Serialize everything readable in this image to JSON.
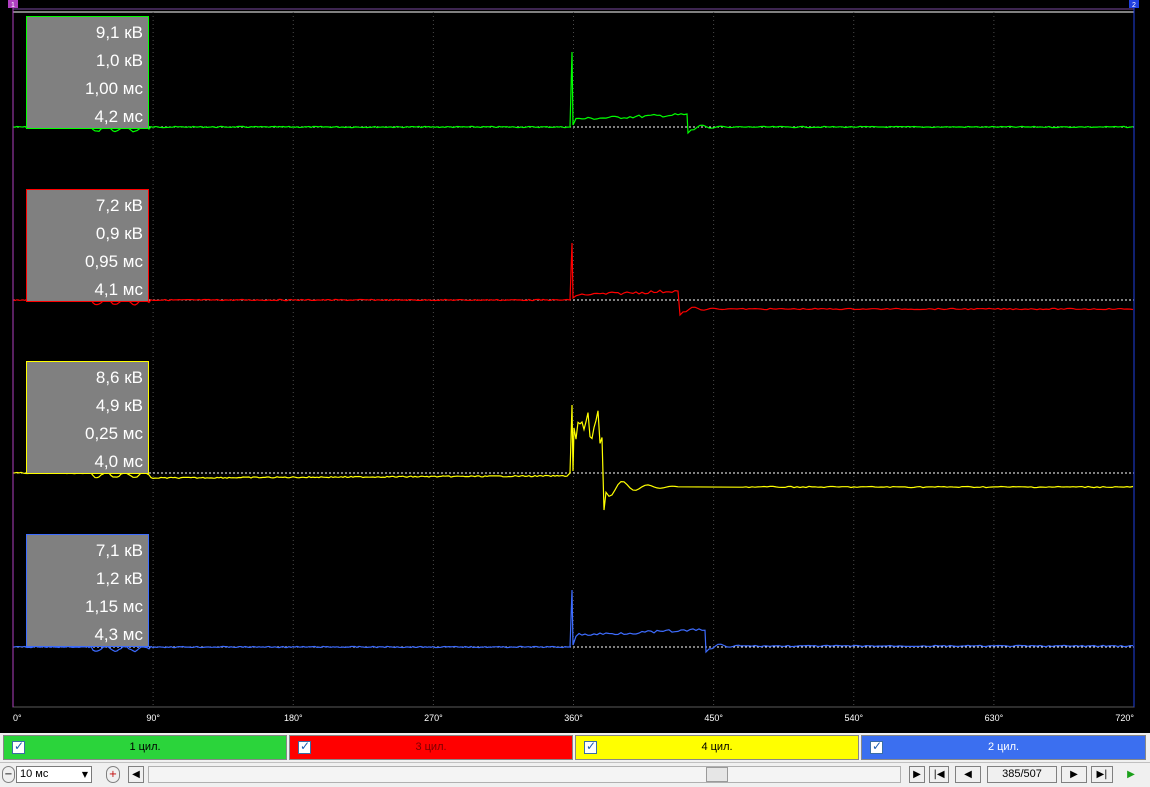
{
  "channels": [
    {
      "label": "1 цил.",
      "color": "#00ff00",
      "tab_color": "#2bd43b",
      "text_color": "#000000",
      "readings": [
        "9,1 кВ",
        "1,0 кВ",
        "1,00 мс",
        "4,2 мс"
      ]
    },
    {
      "label": "3 цил.",
      "color": "#ff0000",
      "tab_color": "#ff0000",
      "text_color": "#7a0000",
      "readings": [
        "7,2 кВ",
        "0,9 кВ",
        "0,95 мс",
        "4,1 мс"
      ]
    },
    {
      "label": "4 цил.",
      "color": "#ffff00",
      "tab_color": "#ffff00",
      "text_color": "#000000",
      "readings": [
        "8,6 кВ",
        "4,9 кВ",
        "0,25 мс",
        "4,0 мс"
      ]
    },
    {
      "label": "2 цил.",
      "color": "#3d6cff",
      "tab_color": "#3b6ff0",
      "text_color": "#ffffff",
      "readings": [
        "7,1 кВ",
        "1,2 кВ",
        "1,15 мс",
        "4,3 мс"
      ]
    }
  ],
  "angle_axis": {
    "labels": [
      "0°",
      "90°",
      "180°",
      "270°",
      "360°",
      "450°",
      "540°",
      "630°",
      "720°"
    ]
  },
  "markers": {
    "left": "1",
    "right": "2"
  },
  "toolbar": {
    "time_scale": "10 мс",
    "zoom_out_icon": "zoom-out-icon",
    "zoom_in_icon": "zoom-in-icon",
    "frame_counter": "385/507"
  }
}
